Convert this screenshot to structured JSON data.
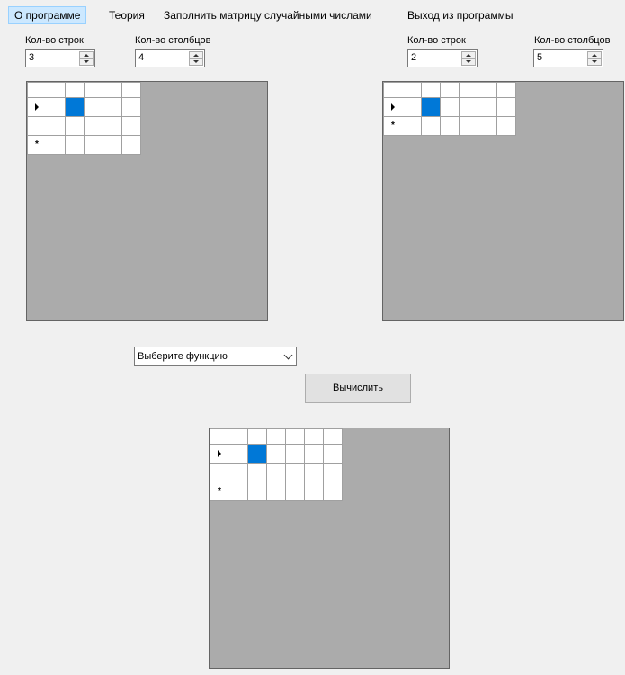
{
  "menu": {
    "items": [
      "О программе",
      "Теория",
      "Заполнить матрицу случайными числами",
      "Выход из программы"
    ]
  },
  "matrix_a": {
    "rows_label": "Кол-во строк",
    "rows_value": "3",
    "cols_label": "Кол-во столбцов",
    "cols_value": "4"
  },
  "matrix_b": {
    "rows_label": "Кол-во строк",
    "rows_value": "2",
    "cols_label": "Кол-во столбцов",
    "cols_value": "5"
  },
  "function_select": {
    "selected": "Выберите функцию"
  },
  "compute_button": {
    "label": "Вычислить"
  },
  "grid": {
    "new_row_marker": "*"
  },
  "colors": {
    "selected_cell": "#0078d7",
    "grid_background": "#ababab",
    "menu_active": "#cce8ff"
  }
}
